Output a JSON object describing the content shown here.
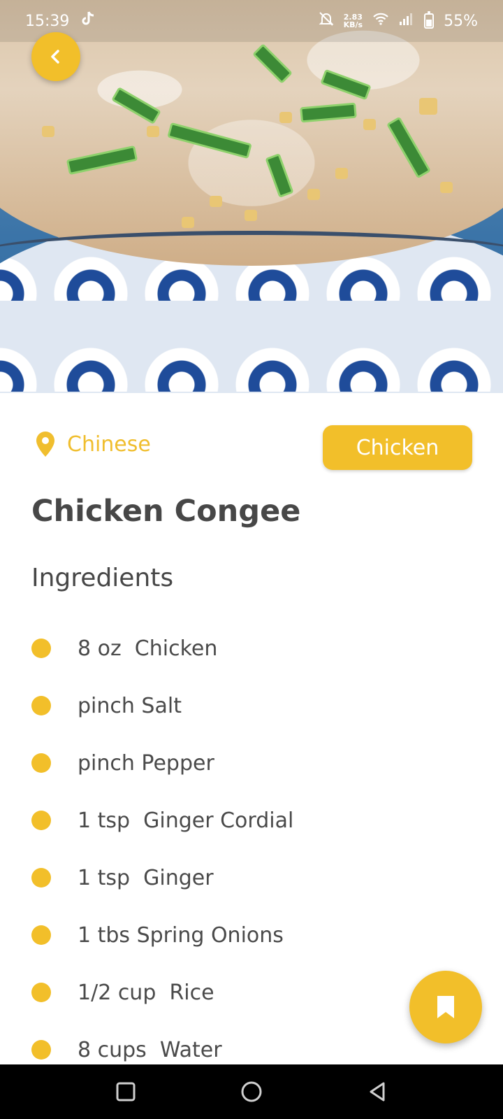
{
  "status_bar": {
    "time": "15:39",
    "net_speed_value": "2.83",
    "net_speed_unit": "KB/s",
    "battery": "55%"
  },
  "recipe": {
    "area": "Chinese",
    "category": "Chicken",
    "title": "Chicken Congee",
    "ingredients_heading": "Ingredients",
    "ingredients": [
      "8 oz  Chicken",
      "pinch Salt",
      "pinch Pepper",
      "1 tsp  Ginger Cordial",
      "1 tsp  Ginger",
      "1 tbs Spring Onions",
      "1/2 cup  Rice",
      "8 cups  Water"
    ]
  },
  "colors": {
    "accent": "#f2bf2a",
    "text": "#474747"
  },
  "icons": {
    "back": "chevron-left-icon",
    "location": "location-pin-icon",
    "bookmark": "bookmark-icon",
    "tiktok": "tiktok-icon",
    "mute": "bell-off-icon",
    "wifi": "wifi-icon",
    "signal": "signal-icon",
    "battery": "battery-icon",
    "nav_recents": "square-icon",
    "nav_home": "circle-icon",
    "nav_back": "triangle-back-icon"
  }
}
